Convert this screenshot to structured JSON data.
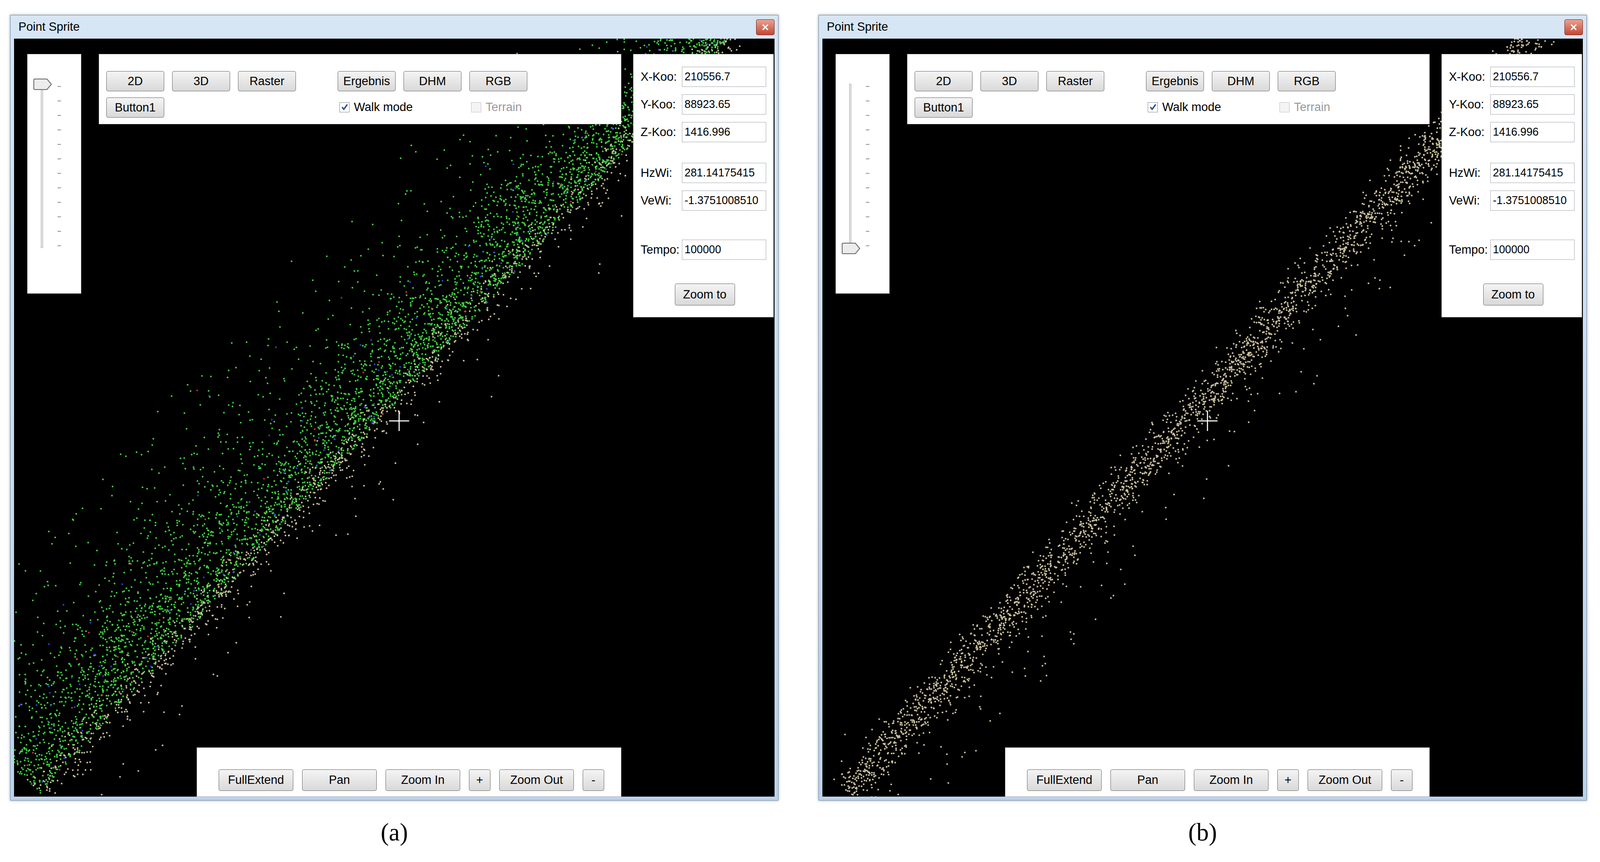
{
  "windows": [
    {
      "caption": "(a)",
      "title": "Point Sprite",
      "slider": {
        "level": 1
      },
      "toolbar": {
        "view_buttons": [
          "2D",
          "3D",
          "Raster"
        ],
        "data_buttons": [
          "Ergebnis",
          "DHM",
          "RGB"
        ],
        "extra_button": "Button1",
        "checkboxes": [
          {
            "label": "Walk mode",
            "checked": true,
            "disabled": false
          },
          {
            "label": "Terrain",
            "checked": false,
            "disabled": true
          }
        ]
      },
      "fields": [
        [
          {
            "label": "X-Koo:",
            "value": "210556.7"
          },
          {
            "label": "Y-Koo:",
            "value": "88923.65"
          },
          {
            "label": "Z-Koo:",
            "value": "1416.996"
          }
        ],
        [
          {
            "label": "HzWi:",
            "value": "281.14175415"
          },
          {
            "label": "VeWi:",
            "value": "-1.3751008510"
          }
        ],
        [
          {
            "label": "Tempo:",
            "value": "100000"
          }
        ]
      ],
      "zoom_to": "Zoom to",
      "nav_buttons": [
        "FullExtend",
        "Pan",
        "Zoom In",
        "+",
        "Zoom Out",
        "-"
      ],
      "point_colors": [
        "#3fd23f",
        "#c9c09c",
        "#3343cc",
        "#cc3333"
      ]
    },
    {
      "caption": "(b)",
      "title": "Point Sprite",
      "slider": {
        "level": 0
      },
      "toolbar": {
        "view_buttons": [
          "2D",
          "3D",
          "Raster"
        ],
        "data_buttons": [
          "Ergebnis",
          "DHM",
          "RGB"
        ],
        "extra_button": "Button1",
        "checkboxes": [
          {
            "label": "Walk mode",
            "checked": true,
            "disabled": false
          },
          {
            "label": "Terrain",
            "checked": false,
            "disabled": true
          }
        ]
      },
      "fields": [
        [
          {
            "label": "X-Koo:",
            "value": "210556.7"
          },
          {
            "label": "Y-Koo:",
            "value": "88923.65"
          },
          {
            "label": "Z-Koo:",
            "value": "1416.996"
          }
        ],
        [
          {
            "label": "HzWi:",
            "value": "281.14175415"
          },
          {
            "label": "VeWi:",
            "value": "-1.3751008510"
          }
        ],
        [
          {
            "label": "Tempo:",
            "value": "100000"
          }
        ]
      ],
      "zoom_to": "Zoom to",
      "nav_buttons": [
        "FullExtend",
        "Pan",
        "Zoom In",
        "+",
        "Zoom Out",
        "-"
      ],
      "point_colors": [
        "#c9c09c"
      ]
    }
  ]
}
